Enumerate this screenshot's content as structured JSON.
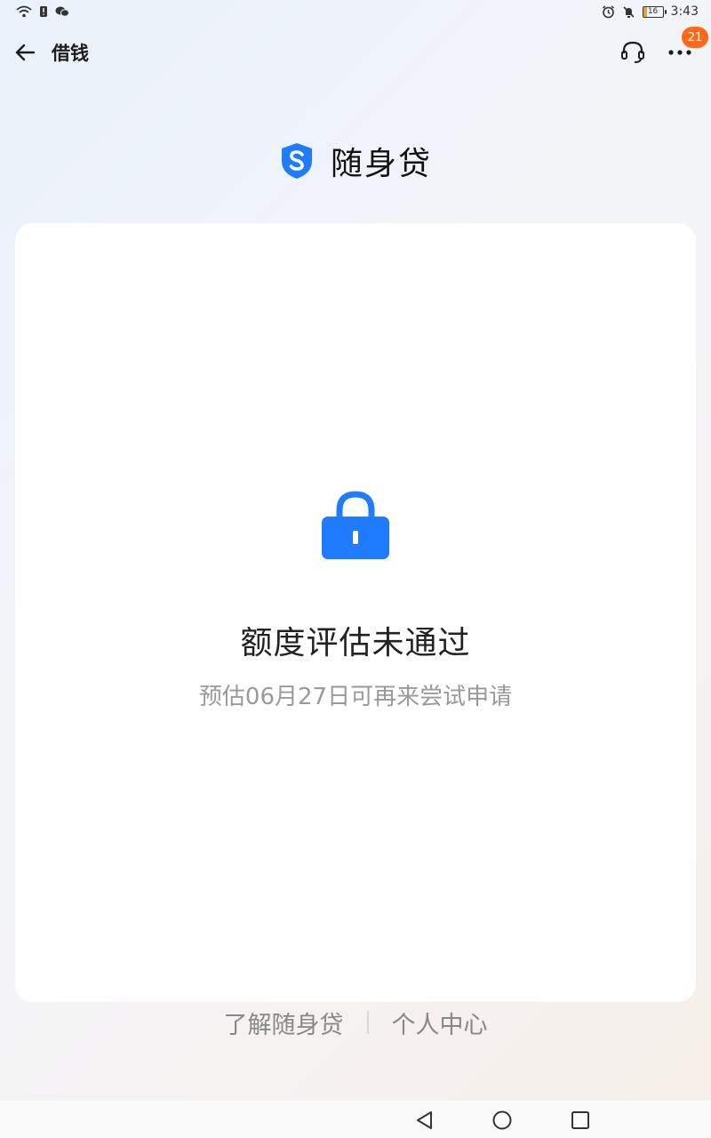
{
  "status_bar": {
    "time": "3:43",
    "battery_level": "16"
  },
  "header": {
    "title": "借钱",
    "notification_count": "21"
  },
  "brand": {
    "name": "随身贷"
  },
  "result": {
    "title": "额度评估未通过",
    "subtitle": "预估06月27日可再来尝试申请"
  },
  "footer": {
    "about_link": "了解随身贷",
    "profile_link": "个人中心"
  },
  "colors": {
    "accent": "#1f7bff",
    "badge": "#ff6a1a"
  },
  "icons": [
    "wifi-icon",
    "sim-alert-icon",
    "wechat-icon",
    "alarm-icon",
    "mute-icon",
    "battery-icon",
    "back-arrow-icon",
    "headset-icon",
    "more-icon",
    "shield-logo-icon",
    "lock-icon",
    "nav-back-icon",
    "nav-home-icon",
    "nav-recents-icon"
  ]
}
